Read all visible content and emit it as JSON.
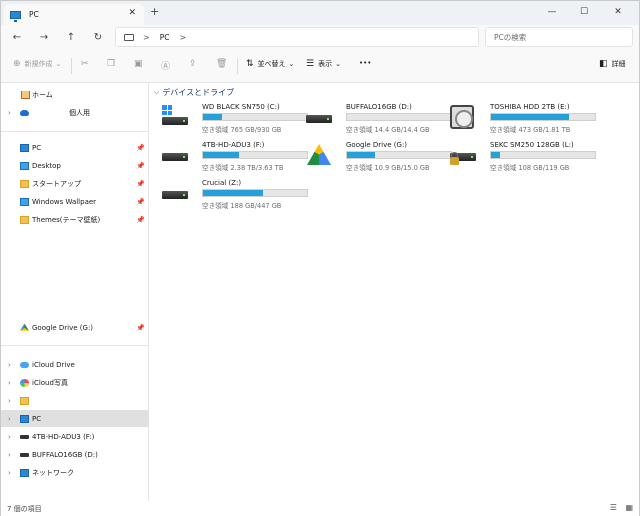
{
  "window": {
    "tab_title": "PC",
    "tab_close": "✕",
    "new_tab": "+",
    "minimize": "—",
    "maximize": "☐",
    "close": "✕"
  },
  "navbar": {
    "back": "←",
    "forward": "→",
    "up": "↑",
    "refresh": "↻",
    "address": "PC",
    "search_placeholder": "PCの検索"
  },
  "toolbar": {
    "new_label": "新規作成",
    "sort_label": "並べ替え",
    "view_label": "表示",
    "more_label": "•••",
    "details_label": "詳細"
  },
  "sidebar": {
    "items": [
      {
        "label": "ホーム",
        "icon": "home-icon"
      },
      {
        "label": "個人用",
        "icon": "onedrive-icon"
      },
      {
        "label": "PC",
        "icon": "pc-icon"
      },
      {
        "label": "Desktop",
        "icon": "desktop-icon"
      },
      {
        "label": "スタートアップ",
        "icon": "folder-icon"
      },
      {
        "label": "Windows Wallpaer",
        "icon": "folder-icon"
      },
      {
        "label": "Themes(テーマ壁紙)",
        "icon": "folder-icon"
      },
      {
        "label": "Google Drive (G:)",
        "icon": "google-drive-icon"
      },
      {
        "label": "iCloud Drive",
        "icon": "icloud-icon"
      },
      {
        "label": "iCloud写真",
        "icon": "photos-icon"
      },
      {
        "label": "",
        "icon": "folder-icon"
      },
      {
        "label": "PC",
        "icon": "pc-icon"
      },
      {
        "label": "4TB-HD-ADU3 (F:)",
        "icon": "drive-icon"
      },
      {
        "label": "BUFFALO16GB (D:)",
        "icon": "drive-icon"
      },
      {
        "label": "ネットワーク",
        "icon": "network-icon"
      }
    ]
  },
  "main": {
    "group_title": "デバイスとドライブ",
    "drives": [
      {
        "name": "WD BLACK SN750 (C:)",
        "free": "空き領域 765 GB/930 GB",
        "used_fraction": 0.18,
        "icon": "windows-drive-icon"
      },
      {
        "name": "BUFFALO16GB (D:)",
        "free": "空き領域 14.4 GB/14.4 GB",
        "used_fraction": 0.0,
        "icon": "hard-drive-icon"
      },
      {
        "name": "TOSHIBA HDD 2TB (E:)",
        "free": "空き領域 473 GB/1.81 TB",
        "used_fraction": 0.75,
        "icon": "hdd-platter-icon"
      },
      {
        "name": "4TB-HD-ADU3 (F:)",
        "free": "空き領域 2.38 TB/3.63 TB",
        "used_fraction": 0.35,
        "icon": "hard-drive-icon"
      },
      {
        "name": "Google Drive (G:)",
        "free": "空き領域 10.9 GB/15.0 GB",
        "used_fraction": 0.27,
        "icon": "google-drive-icon"
      },
      {
        "name": "SEKC SM250 128GB (L:)",
        "free": "空き領域 108 GB/119 GB",
        "used_fraction": 0.09,
        "icon": "locked-drive-icon"
      },
      {
        "name": "Crucial (Z:)",
        "free": "空き領域 188 GB/447 GB",
        "used_fraction": 0.58,
        "icon": "hard-drive-icon"
      }
    ]
  },
  "status": {
    "item_count": "7 個の項目"
  },
  "colors": {
    "accent": "#26a0da",
    "selected": "#e0e0e0"
  }
}
